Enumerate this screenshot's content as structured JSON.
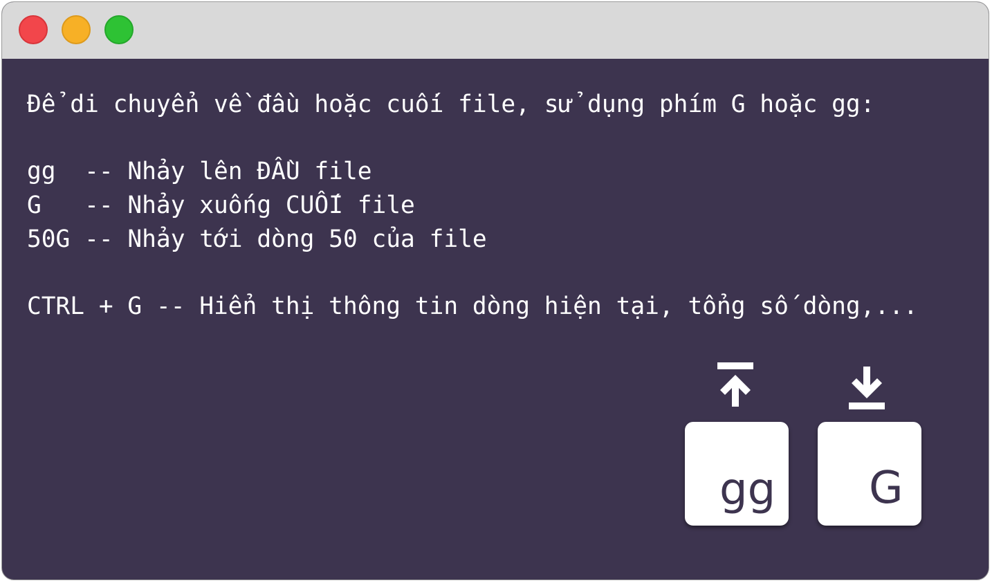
{
  "window": {
    "controls": {
      "close": "red",
      "minimize": "yellow",
      "zoom": "green"
    }
  },
  "terminal": {
    "lines": [
      "Để di chuyển về đầu hoặc cuối file, sử dụng phím G hoặc gg:",
      "gg  -- Nhảy lên ĐẦU file",
      "G   -- Nhảy xuống CUỐI file",
      "50G -- Nhảy tới dòng 50 của file",
      "CTRL + G -- Hiển thị thông tin dòng hiện tại, tổng số dòng,..."
    ]
  },
  "keys": [
    {
      "label": "gg",
      "icon": "arrow-to-top-icon"
    },
    {
      "label": "G",
      "icon": "arrow-to-bottom-icon"
    }
  ],
  "colors": {
    "terminal_bg": "#3d344f",
    "titlebar_bg": "#d9d9d9",
    "text": "#ffffff",
    "key_bg": "#ffffff",
    "key_text": "#3d344f"
  }
}
